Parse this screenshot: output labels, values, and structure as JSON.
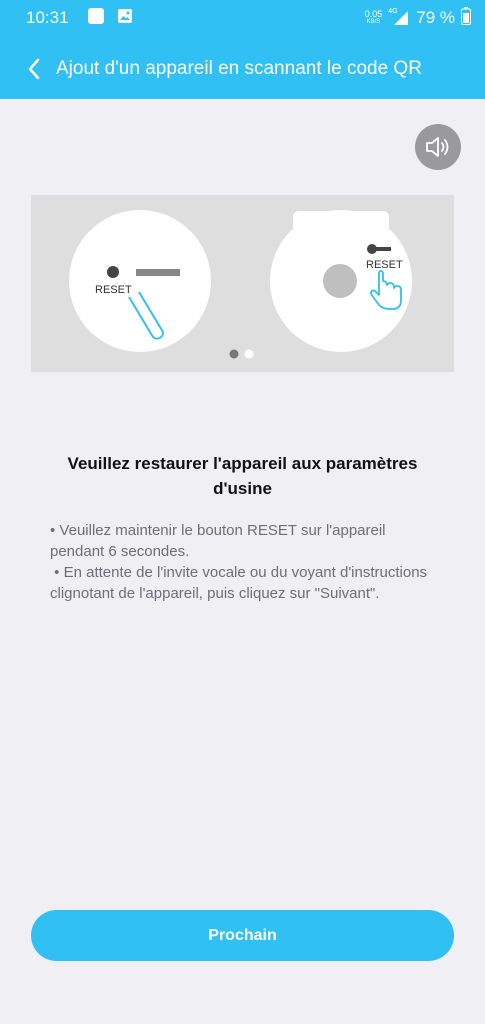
{
  "status_bar": {
    "time": "10:31",
    "net_speed_value": "0.05",
    "net_speed_unit": "KB/S",
    "network": "4G",
    "battery": "79 %"
  },
  "header": {
    "title": "Ajout d'un appareil en scannant le code QR"
  },
  "illustration": {
    "reset_label_left": "RESET",
    "reset_label_right": "RESET",
    "carousel_pages": 2,
    "carousel_active": 1
  },
  "content": {
    "heading": "Veuillez restaurer l'appareil aux paramètres d'usine",
    "instruction_1": "• Veuillez maintenir le bouton RESET sur l'appareil pendant 6 secondes.",
    "instruction_2": " • En attente de l'invite vocale ou du voyant d'instructions clignotant de l'appareil, puis cliquez sur \"Suivant\"."
  },
  "footer": {
    "next_label": "Prochain"
  },
  "colors": {
    "accent": "#30c0f4",
    "background": "#efeff4",
    "illustration_bg": "#dededf"
  }
}
